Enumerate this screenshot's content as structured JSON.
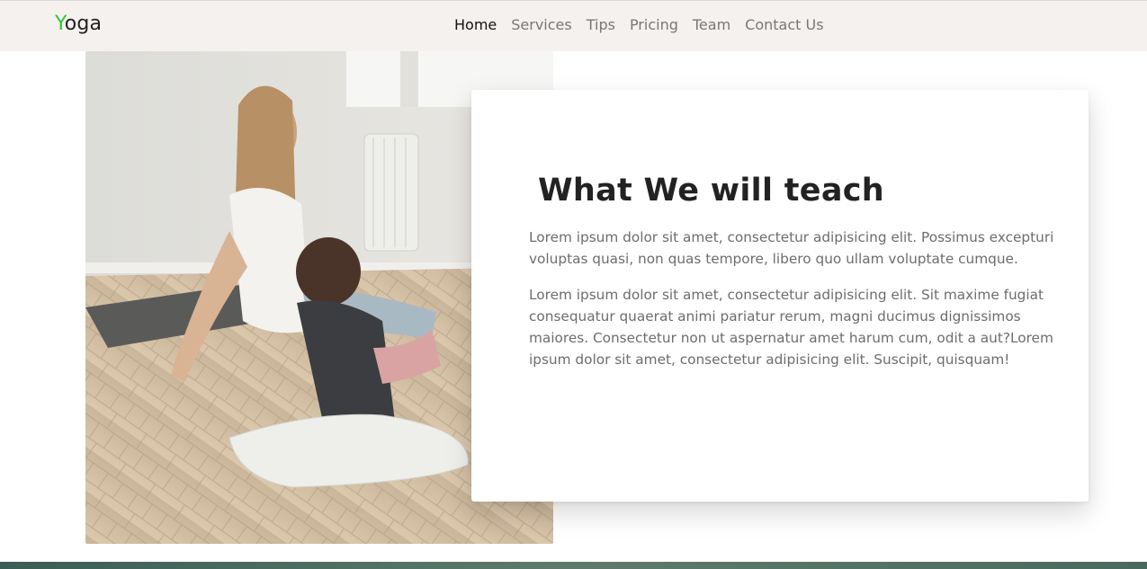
{
  "brand": {
    "first_letter": "Y",
    "rest": "oga",
    "accent_color": "#36c23e"
  },
  "nav": {
    "items": [
      {
        "label": "Home",
        "active": true
      },
      {
        "label": "Services",
        "active": false
      },
      {
        "label": "Tips",
        "active": false
      },
      {
        "label": "Pricing",
        "active": false
      },
      {
        "label": "Team",
        "active": false
      },
      {
        "label": "Contact Us",
        "active": false
      }
    ]
  },
  "about": {
    "heading": "What We will teach",
    "paragraph1": "Lorem ipsum dolor sit amet, consectetur adipisicing elit. Possimus excepturi voluptas quasi, non quas tempore, libero quo ullam voluptate cumque.",
    "paragraph2": "Lorem ipsum dolor sit amet, consectetur adipisicing elit. Sit maxime fugiat consequatur quaerat animi pariatur rerum, magni ducimus dignissimos maiores. Consectetur non ut aspernatur amet harum cum, odit a aut?Lorem ipsum dolor sit amet, consectetur adipisicing elit. Suscipit, quisquam!"
  },
  "colors": {
    "navbar_bg": "#f5f1ef",
    "text_muted": "#6d6d6d",
    "footer_band": "#4a6a5f"
  }
}
